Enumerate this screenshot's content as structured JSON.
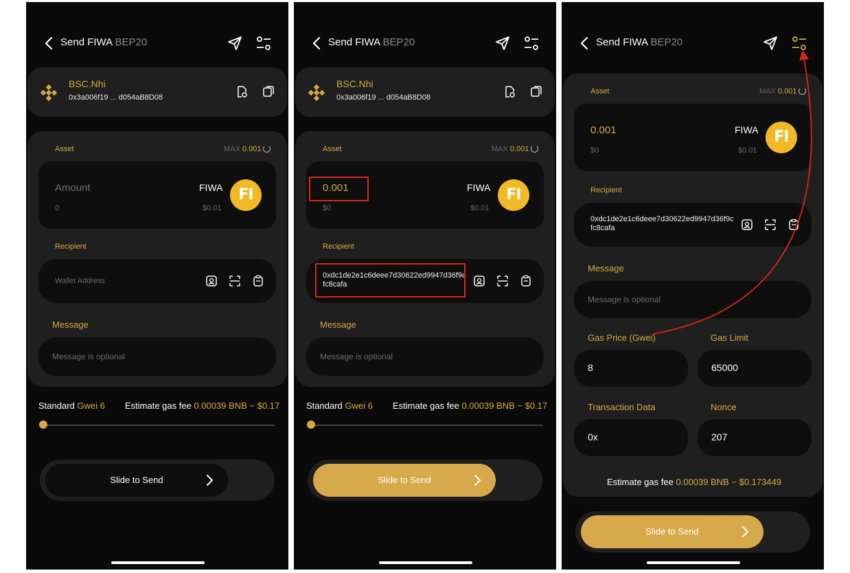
{
  "header": {
    "title": "Send FIWA",
    "network": "BEP20"
  },
  "wallet": {
    "name": "BSC.Nhi",
    "address": "0x3a006f19 ... d054aB8D08"
  },
  "asset": {
    "label": "Asset",
    "max_label": "MAX",
    "max_value": "0.001",
    "amount_placeholder": "Amount",
    "amount_value": "0.001",
    "fiat_empty": "0",
    "fiat_value": "$0",
    "coin_name": "FIWA",
    "coin_price": "$0.01",
    "coin_logo_text": "FI"
  },
  "recipient": {
    "label": "Recipient",
    "placeholder": "Wallet Address",
    "value": "0xdc1de2e1c6deee7d30622ed9947d36f9cfc8cafa"
  },
  "message": {
    "label": "Message",
    "placeholder": "Message is optional"
  },
  "gas": {
    "standard_label": "Standard",
    "gwei_label": "Gwei 6",
    "estimate_label": "Estimate gas fee",
    "estimate_value": "0.00039 BNB ~ $0.17",
    "estimate_value_detail": "0.00039 BNB ~ $0.173449",
    "slider_level": 0
  },
  "advanced": {
    "gas_price_label": "Gas Price (Gwei)",
    "gas_price_value": "8",
    "gas_limit_label": "Gas Limit",
    "gas_limit_value": "65000",
    "tx_data_label": "Transaction Data",
    "tx_data_value": "0x",
    "nonce_label": "Nonce",
    "nonce_value": "207"
  },
  "send": {
    "label": "Slide to Send"
  },
  "colors": {
    "accent": "#d6a93f",
    "highlight": "#d8261b",
    "background": "#0a0a0a",
    "card": "#1f1f1f"
  },
  "icons": [
    "back-arrow-icon",
    "send-icon",
    "settings-sliders-icon",
    "bnb-icon",
    "copy-search-icon",
    "copy-icon",
    "contact-icon",
    "scan-icon",
    "clipboard-icon",
    "chevron-right-icon"
  ]
}
